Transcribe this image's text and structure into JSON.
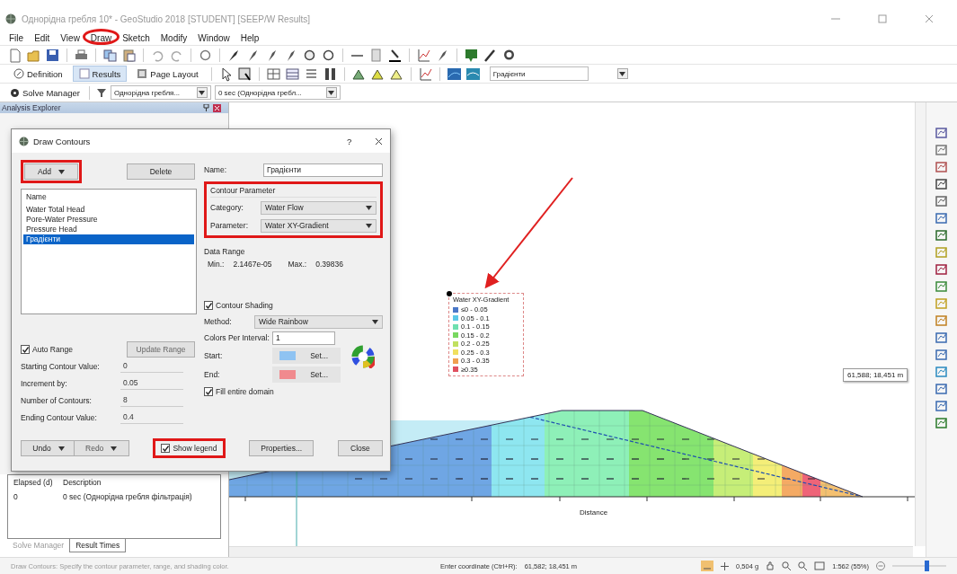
{
  "window": {
    "title": "Однорідна гребля 10* - GeoStudio 2018 [STUDENT] [SEEP/W Results]"
  },
  "menu": [
    {
      "label": "File",
      "circled": false
    },
    {
      "label": "Edit",
      "circled": false
    },
    {
      "label": "View",
      "circled": false
    },
    {
      "label": "Draw",
      "circled": true
    },
    {
      "label": "Sketch",
      "circled": false
    },
    {
      "label": "Modify",
      "circled": false
    },
    {
      "label": "Window",
      "circled": false
    },
    {
      "label": "Help",
      "circled": false
    }
  ],
  "view_tabs": [
    {
      "label": "Definition",
      "selected": false
    },
    {
      "label": "Results",
      "selected": true
    },
    {
      "label": "Page Layout",
      "selected": false
    }
  ],
  "contour_dropdown": {
    "value": "Градієнти"
  },
  "solve_bar": {
    "button": "Solve Manager",
    "analysis": "Однорідна гребля...",
    "time": "0 sec (Однорідна гребл..."
  },
  "analysis_explorer": {
    "title": "Analysis Explorer"
  },
  "dialog": {
    "title": "Draw Contours",
    "help": "?",
    "add": "Add",
    "delete": "Delete",
    "list_header": "Name",
    "items": [
      {
        "label": "Water Total Head",
        "selected": false
      },
      {
        "label": "Pore-Water Pressure",
        "selected": false
      },
      {
        "label": "Pressure Head",
        "selected": false
      },
      {
        "label": "Градієнти",
        "selected": true
      }
    ],
    "name_label": "Name:",
    "name_value": "Градієнти",
    "parameter_group": "Contour Parameter",
    "category_label": "Category:",
    "category": "Water Flow",
    "parameter_label": "Parameter:",
    "parameter": "Water XY-Gradient",
    "data_range": "Data Range",
    "min_label": "Min.:",
    "min": "2.1467e-05",
    "max_label": "Max.:",
    "max": "0.39836",
    "auto_range": {
      "label": "Auto Range",
      "checked": true
    },
    "update_range": "Update Range",
    "fields": [
      {
        "label": "Starting Contour Value:",
        "value": "0"
      },
      {
        "label": "Increment by:",
        "value": "0.05"
      },
      {
        "label": "Number of Contours:",
        "value": "8"
      },
      {
        "label": "Ending Contour Value:",
        "value": "0.4"
      }
    ],
    "shading": {
      "label": "Contour Shading",
      "checked": true
    },
    "method_label": "Method:",
    "method": "Wide Rainbow",
    "colors_label": "Colors Per Interval:",
    "colors_value": "1",
    "start_label": "Start:",
    "end_label": "End:",
    "set_start": "Set...",
    "set_end": "Set...",
    "fill": {
      "label": "Fill entire domain",
      "checked": true
    },
    "undo": "Undo",
    "redo": "Redo",
    "show_legend": {
      "label": "Show legend",
      "checked": true
    },
    "properties": "Properties...",
    "close": "Close"
  },
  "results_table": {
    "columns": [
      "Elapsed (d)",
      "Description"
    ],
    "rows": [
      [
        "0",
        "0 sec (Однорідна гребля фільтрація)"
      ]
    ]
  },
  "bottom_tabs": [
    {
      "label": "Solve Manager",
      "selected": false
    },
    {
      "label": "Result Times",
      "selected": true
    }
  ],
  "legend": {
    "title": "Water XY-Gradient",
    "items": [
      {
        "label": "≤0 - 0.05",
        "color": "#4a78c8"
      },
      {
        "label": "0.05 - 0.1",
        "color": "#5bc8e8"
      },
      {
        "label": "0.1 - 0.15",
        "color": "#6ee0b0"
      },
      {
        "label": "0.15 - 0.2",
        "color": "#78d860"
      },
      {
        "label": "0.2 - 0.25",
        "color": "#c0e060"
      },
      {
        "label": "0.25 - 0.3",
        "color": "#f0e060"
      },
      {
        "label": "0.3 - 0.35",
        "color": "#f0a050"
      },
      {
        "label": "≥0.35",
        "color": "#e05060"
      }
    ]
  },
  "coordinate_tip": "61,588; 18,451 m",
  "axis": {
    "xlabel": "Distance"
  },
  "status_bar": {
    "message": "Draw Contours: Specify the contour parameter, range, and shading color.",
    "coordinate_label": "Enter coordinate (Ctrl+R):",
    "coordinate": "61,582; 18,451 m",
    "gravity": "0,504 g",
    "scale": "1:562 (55%)"
  }
}
